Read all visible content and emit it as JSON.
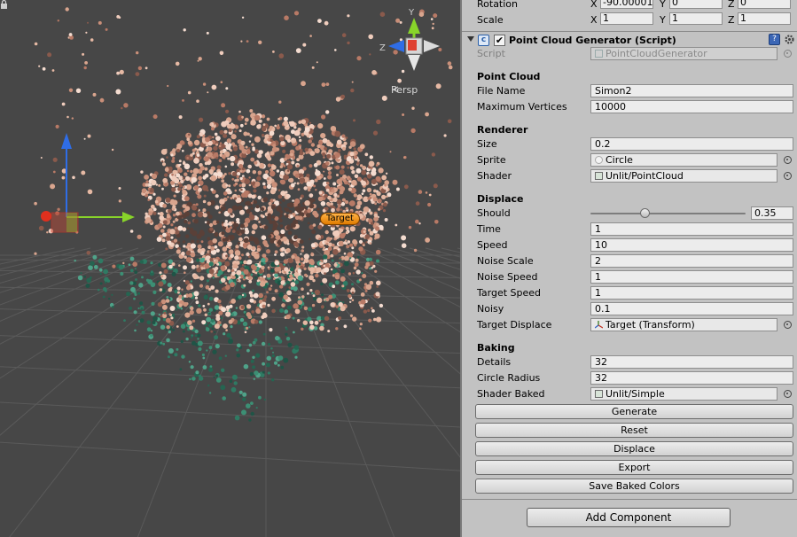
{
  "scene": {
    "view_mode": "Persp",
    "target_label": "Target"
  },
  "transform": {
    "rotation": {
      "label": "Rotation",
      "x": "-90.00001",
      "y": "0",
      "z": "0"
    },
    "scale": {
      "label": "Scale",
      "x": "1",
      "y": "1",
      "z": "1"
    }
  },
  "component": {
    "title": "Point Cloud Generator (Script)",
    "enabled": true,
    "script": {
      "label": "Script",
      "value": "PointCloudGenerator"
    }
  },
  "sections": {
    "point_cloud": "Point Cloud",
    "renderer": "Renderer",
    "displace": "Displace",
    "baking": "Baking"
  },
  "fields": {
    "file_name": {
      "label": "File Name",
      "value": "Simon2"
    },
    "max_vertices": {
      "label": "Maximum Vertices",
      "value": "10000"
    },
    "size": {
      "label": "Size",
      "value": "0.2"
    },
    "sprite": {
      "label": "Sprite",
      "value": "Circle"
    },
    "shader": {
      "label": "Shader",
      "value": "Unlit/PointCloud"
    },
    "should": {
      "label": "Should",
      "value": "0.35",
      "fraction": 0.35
    },
    "time": {
      "label": "Time",
      "value": "1"
    },
    "speed": {
      "label": "Speed",
      "value": "10"
    },
    "noise_scale": {
      "label": "Noise Scale",
      "value": "2"
    },
    "noise_speed": {
      "label": "Noise Speed",
      "value": "1"
    },
    "target_speed": {
      "label": "Target Speed",
      "value": "1"
    },
    "noisy": {
      "label": "Noisy",
      "value": "0.1"
    },
    "target_displace": {
      "label": "Target Displace",
      "value": "Target (Transform)"
    },
    "details": {
      "label": "Details",
      "value": "32"
    },
    "circle_radius": {
      "label": "Circle Radius",
      "value": "32"
    },
    "shader_baked": {
      "label": "Shader Baked",
      "value": "Unlit/Simple"
    }
  },
  "buttons": {
    "generate": "Generate",
    "reset": "Reset",
    "displace": "Displace",
    "export": "Export",
    "save_baked_colors": "Save Baked Colors",
    "add_component": "Add Component"
  },
  "axis_letters": {
    "x": "X",
    "y": "Y",
    "z": "Z"
  },
  "colors": {
    "scene_bg": "#474747",
    "inspector_bg": "#c2c2c2",
    "skin": "#d9a58e",
    "teal": "#2f7a63",
    "gizmo_x": "#e0301e",
    "gizmo_y": "#88d42a",
    "gizmo_z": "#2f6de6",
    "target_badge": "#f09a1a"
  }
}
